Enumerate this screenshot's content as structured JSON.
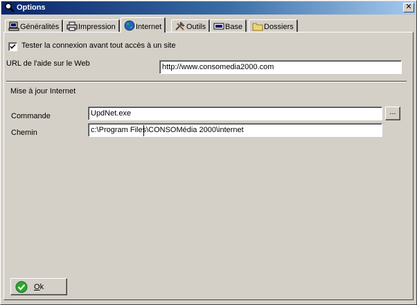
{
  "window": {
    "title": "Options",
    "close_label": "✕"
  },
  "tabs": [
    {
      "label": "Généralités",
      "icon": "computer-icon"
    },
    {
      "label": "Impression",
      "icon": "printer-icon"
    },
    {
      "label": "Internet",
      "icon": "globe-icon",
      "active": true
    },
    {
      "label": "Outils",
      "icon": "tools-icon"
    },
    {
      "label": "Base",
      "icon": "database-icon"
    },
    {
      "label": "Dossiers",
      "icon": "folder-icon"
    }
  ],
  "internet": {
    "test_connection_label": "Tester la connexion avant tout accès à un site",
    "test_connection_checked": true,
    "help_url_label": "URL de l'aide sur le Web",
    "help_url_value": "http://www.consomedia2000.com",
    "update_section_title": "Mise à jour Internet",
    "command_label": "Commande",
    "command_value": "UpdNet.exe",
    "browse_label": "...",
    "path_label": "Chemin",
    "path_value": "c:\\Program Files\\CONSOMédia 2000\\internet"
  },
  "footer": {
    "ok_label": "Ok"
  },
  "colors": {
    "titlebar_start": "#0a246a",
    "titlebar_end": "#a6caf0",
    "face": "#d4d0c8",
    "ok_green": "#2fa52f"
  }
}
